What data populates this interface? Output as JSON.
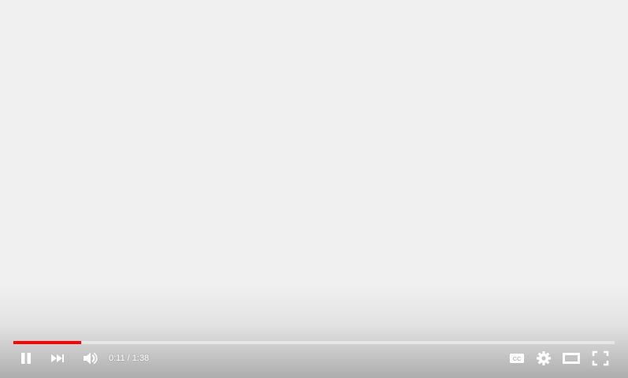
{
  "player": {
    "progress": {
      "played_fraction": 0.1122,
      "loaded_fraction": 0.1122
    },
    "time": {
      "current": "0:11",
      "separator": " / ",
      "duration": "1:38"
    },
    "controls": {
      "left": [
        "pause-icon",
        "next-icon",
        "volume-icon"
      ],
      "right": [
        "captions-icon",
        "settings-icon",
        "theater-mode-icon",
        "fullscreen-icon"
      ],
      "captions_label": "CC"
    },
    "colors": {
      "progress_played": "#ff0000",
      "icon": "#ffffff",
      "background": "#f0f0f0"
    }
  }
}
